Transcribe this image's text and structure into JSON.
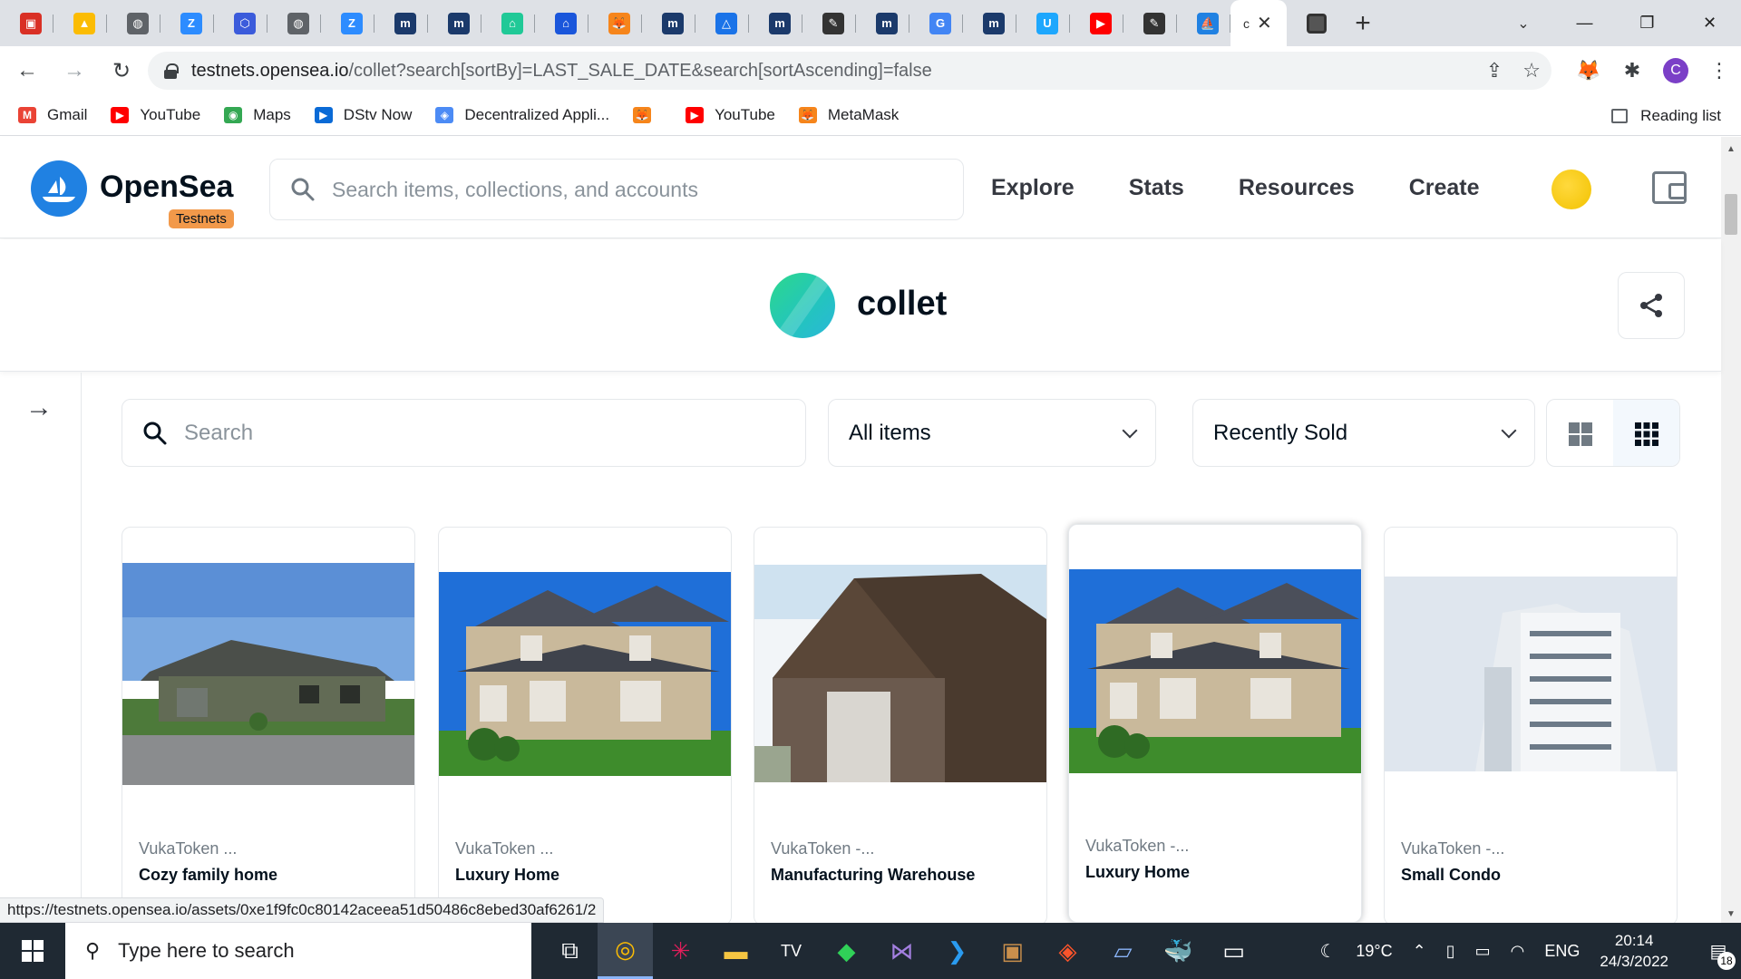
{
  "browser": {
    "tabs": [
      {
        "icon": "red-square-icon",
        "color": "#d93025"
      },
      {
        "icon": "drive-icon",
        "color": "#fbbc04"
      },
      {
        "icon": "globe-icon",
        "color": "#5f6368"
      },
      {
        "icon": "zoom-icon",
        "color": "#2d8cff"
      },
      {
        "icon": "hexagon-icon",
        "color": "#3b5bdb"
      },
      {
        "icon": "globe-icon",
        "color": "#5f6368"
      },
      {
        "icon": "zoom-icon",
        "color": "#2d8cff"
      },
      {
        "icon": "moralis-icon",
        "color": "#1b3a6b"
      },
      {
        "icon": "moralis-icon",
        "color": "#1b3a6b"
      },
      {
        "icon": "home-icon",
        "color": "#20c997"
      },
      {
        "icon": "house-icon",
        "color": "#1a56db"
      },
      {
        "icon": "metamask-icon",
        "color": "#f6851b"
      },
      {
        "icon": "moralis-icon",
        "color": "#1b3a6b"
      },
      {
        "icon": "triangle-icon",
        "color": "#1a73e8"
      },
      {
        "icon": "moralis-icon",
        "color": "#1b3a6b"
      },
      {
        "icon": "feather-icon",
        "color": "#333333"
      },
      {
        "icon": "moralis-icon",
        "color": "#1b3a6b"
      },
      {
        "icon": "google-icon",
        "color": "#4285f4"
      },
      {
        "icon": "moralis-icon",
        "color": "#1b3a6b"
      },
      {
        "icon": "u-icon",
        "color": "#1ea7fd"
      },
      {
        "icon": "youtube-icon",
        "color": "#ff0000"
      },
      {
        "icon": "feather-icon",
        "color": "#333333"
      },
      {
        "icon": "opensea-icon",
        "color": "#2081e2"
      }
    ],
    "active_tab_label": "c",
    "url_host": "testnets.opensea.io",
    "url_path": "/collet?search[sortBy]=LAST_SALE_DATE&search[sortAscending]=false",
    "bookmarks": [
      {
        "label": "Gmail",
        "icon": "gmail-icon",
        "color": "#ea4335"
      },
      {
        "label": "YouTube",
        "icon": "youtube-icon",
        "color": "#ff0000"
      },
      {
        "label": "Maps",
        "icon": "maps-icon",
        "color": "#34a853"
      },
      {
        "label": "DStv Now",
        "icon": "dstv-icon",
        "color": "#0a6ad6"
      },
      {
        "label": "Decentralized Appli...",
        "icon": "dapp-icon",
        "color": "#4c8bf5"
      },
      {
        "label": "",
        "icon": "metamask-icon",
        "color": "#f6851b"
      },
      {
        "label": "YouTube",
        "icon": "youtube-icon",
        "color": "#ff0000"
      },
      {
        "label": "MetaMask",
        "icon": "metamask-icon",
        "color": "#f6851b"
      }
    ],
    "reading_list": "Reading list",
    "status_url": "https://testnets.opensea.io/assets/0xe1f9fc0c80142aceea51d50486c8ebed30af6261/2"
  },
  "header": {
    "brand": "OpenSea",
    "badge": "Testnets",
    "search_placeholder": "Search items, collections, and accounts",
    "nav": [
      "Explore",
      "Stats",
      "Resources",
      "Create"
    ],
    "accent": "#2081e2"
  },
  "collection": {
    "name": "collet"
  },
  "filters": {
    "search_placeholder": "Search",
    "items_select": "All items",
    "sort_select": "Recently Sold"
  },
  "cards": [
    {
      "collection": "VukaToken ...",
      "name": "Cozy family home",
      "image": "green-bungalow"
    },
    {
      "collection": "VukaToken ...",
      "name": "Luxury Home",
      "image": "two-storey-house"
    },
    {
      "collection": "VukaToken -...",
      "name": "Manufacturing Warehouse",
      "image": "brown-barn"
    },
    {
      "collection": "VukaToken -...",
      "name": "Luxury Home",
      "image": "two-storey-house"
    },
    {
      "collection": "VukaToken -...",
      "name": "Small Condo",
      "image": "apartment-tower"
    }
  ],
  "taskbar": {
    "search_placeholder": "Type here to search",
    "apps": [
      "task-view-icon",
      "chrome-icon",
      "slack-icon",
      "file-explorer-icon",
      "tradingview-icon",
      "gitkraken-icon",
      "visual-studio-icon",
      "vscode-icon",
      "box-icon",
      "brave-icon",
      "notepad-icon",
      "docker-icon",
      "terminal-icon"
    ],
    "weather": "19°C",
    "language": "ENG",
    "time": "20:14",
    "date": "24/3/2022",
    "notifications": "18"
  }
}
